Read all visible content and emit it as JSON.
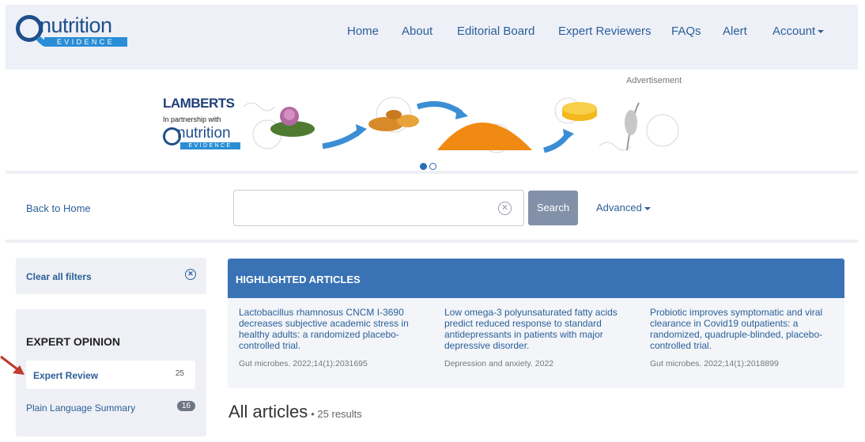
{
  "header": {
    "logo_text": "nutrition",
    "logo_sub": "EVIDENCE",
    "nav": {
      "home": "Home",
      "about": "About",
      "editorial": "Editorial Board",
      "expert": "Expert Reviewers",
      "faqs": "FAQs",
      "alert": "Alert",
      "account": "Account"
    }
  },
  "ad": {
    "label": "Advertisement",
    "brand": "LAMBERTS",
    "partner": "In partnership with",
    "logo_text": "nutrition",
    "logo_sub": "EVIDENCE"
  },
  "search": {
    "back": "Back to Home",
    "placeholder": "",
    "button": "Search",
    "advanced": "Advanced"
  },
  "filters": {
    "clear": "Clear all filters",
    "section_title": "EXPERT OPINION",
    "items": [
      {
        "label": "Expert Review",
        "count": "25"
      },
      {
        "label": "Plain Language Summary",
        "count": "16"
      }
    ]
  },
  "highlighted": {
    "title": "HIGHLIGHTED ARTICLES",
    "articles": [
      {
        "title": "Lactobacillus rhamnosus CNCM I-3690 decreases subjective academic stress in healthy adults: a randomized placebo-controlled trial.",
        "meta": "Gut microbes. 2022;14(1):2031695"
      },
      {
        "title": "Low omega-3 polyunsaturated fatty acids predict reduced response to standard antidepressants in patients with major depressive disorder.",
        "meta": "Depression and anxiety. 2022"
      },
      {
        "title": "Probiotic improves symptomatic and viral clearance in Covid19 outpatients: a randomized, quadruple-blinded, placebo-controlled trial.",
        "meta": "Gut microbes. 2022;14(1):2018899"
      }
    ]
  },
  "results": {
    "heading": "All articles",
    "count": "• 25 results"
  },
  "colors": {
    "link": "#2a5f98",
    "header_bg": "#eef0f8",
    "highlight_bar": "#3a73b5",
    "search_button": "#8391a8",
    "arrow": "#c0392b"
  }
}
